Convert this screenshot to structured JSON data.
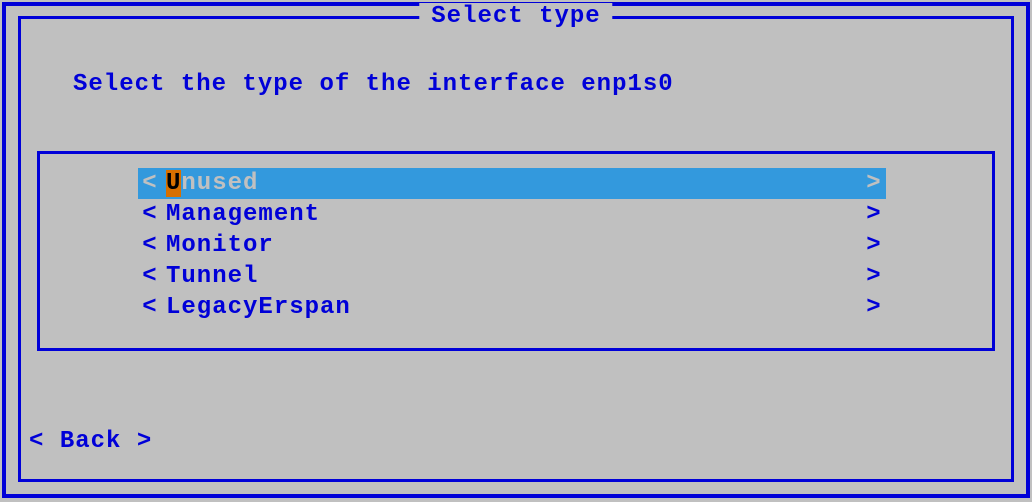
{
  "title": "Select type",
  "prompt": "Select the type of the interface enp1s0",
  "list": {
    "items": [
      {
        "label": "Unused",
        "hotkey_index": 0,
        "selected": true
      },
      {
        "label": "Management",
        "hotkey_index": null,
        "selected": false
      },
      {
        "label": "Monitor",
        "hotkey_index": null,
        "selected": false
      },
      {
        "label": "Tunnel",
        "hotkey_index": null,
        "selected": false
      },
      {
        "label": "LegacyErspan",
        "hotkey_index": null,
        "selected": false
      }
    ]
  },
  "back_label": "Back",
  "brackets": {
    "left": "<",
    "right": ">"
  }
}
